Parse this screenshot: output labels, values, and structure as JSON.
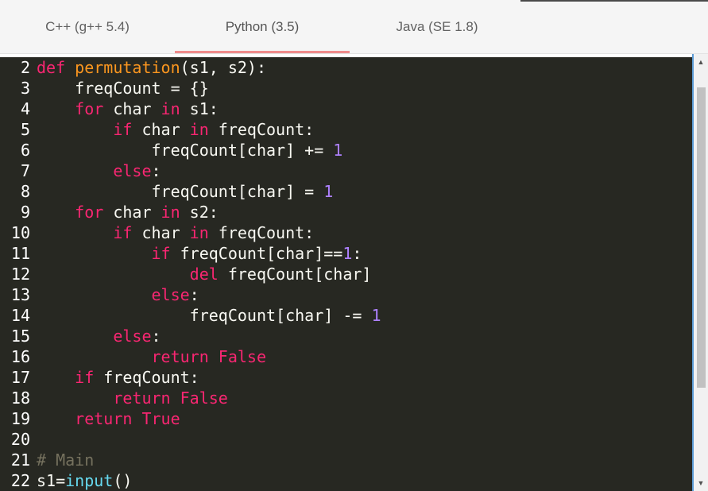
{
  "tabs": [
    {
      "label": "C++ (g++ 5.4)",
      "active": false
    },
    {
      "label": "Python (3.5)",
      "active": true
    },
    {
      "label": "Java (SE 1.8)",
      "active": false
    }
  ],
  "colors": {
    "editor_bg": "#272822",
    "keyword": "#f92672",
    "function": "#fd971f",
    "number": "#ae81ff",
    "builtin": "#66d9ef",
    "comment": "#75715e",
    "text": "#f8f8f2",
    "tab_indicator": "#ef8c8c",
    "scrollbar_border": "#5b9bd5"
  },
  "scrollbar": {
    "up_icon": "arrow-up-icon",
    "down_icon": "arrow-down-icon"
  },
  "code_lines": [
    {
      "num": "2",
      "tokens": [
        [
          "kw",
          "def"
        ],
        [
          "p",
          " "
        ],
        [
          "fn",
          "permutation"
        ],
        [
          "p",
          "(s1, s2):"
        ]
      ]
    },
    {
      "num": "3",
      "tokens": [
        [
          "p",
          "    freqCount = {}"
        ]
      ]
    },
    {
      "num": "4",
      "tokens": [
        [
          "p",
          "    "
        ],
        [
          "kw",
          "for"
        ],
        [
          "p",
          " char "
        ],
        [
          "kw",
          "in"
        ],
        [
          "p",
          " s1:"
        ]
      ]
    },
    {
      "num": "5",
      "tokens": [
        [
          "p",
          "        "
        ],
        [
          "kw",
          "if"
        ],
        [
          "p",
          " char "
        ],
        [
          "kw",
          "in"
        ],
        [
          "p",
          " freqCount:"
        ]
      ]
    },
    {
      "num": "6",
      "tokens": [
        [
          "p",
          "            freqCount[char] += "
        ],
        [
          "num",
          "1"
        ]
      ]
    },
    {
      "num": "7",
      "tokens": [
        [
          "p",
          "        "
        ],
        [
          "kw",
          "else"
        ],
        [
          "p",
          ":"
        ]
      ]
    },
    {
      "num": "8",
      "tokens": [
        [
          "p",
          "            freqCount[char] = "
        ],
        [
          "num",
          "1"
        ]
      ]
    },
    {
      "num": "9",
      "tokens": [
        [
          "p",
          "    "
        ],
        [
          "kw",
          "for"
        ],
        [
          "p",
          " char "
        ],
        [
          "kw",
          "in"
        ],
        [
          "p",
          " s2:"
        ]
      ]
    },
    {
      "num": "10",
      "tokens": [
        [
          "p",
          "        "
        ],
        [
          "kw",
          "if"
        ],
        [
          "p",
          " char "
        ],
        [
          "kw",
          "in"
        ],
        [
          "p",
          " freqCount:"
        ]
      ]
    },
    {
      "num": "11",
      "tokens": [
        [
          "p",
          "            "
        ],
        [
          "kw",
          "if"
        ],
        [
          "p",
          " freqCount[char]=="
        ],
        [
          "num",
          "1"
        ],
        [
          "p",
          ":"
        ]
      ]
    },
    {
      "num": "12",
      "tokens": [
        [
          "p",
          "                "
        ],
        [
          "kw",
          "del"
        ],
        [
          "p",
          " freqCount[char]"
        ]
      ]
    },
    {
      "num": "13",
      "tokens": [
        [
          "p",
          "            "
        ],
        [
          "kw",
          "else"
        ],
        [
          "p",
          ":"
        ]
      ]
    },
    {
      "num": "14",
      "tokens": [
        [
          "p",
          "                freqCount[char] -= "
        ],
        [
          "num",
          "1"
        ]
      ]
    },
    {
      "num": "15",
      "tokens": [
        [
          "p",
          "        "
        ],
        [
          "kw",
          "else"
        ],
        [
          "p",
          ":"
        ]
      ]
    },
    {
      "num": "16",
      "tokens": [
        [
          "p",
          "            "
        ],
        [
          "kw",
          "return"
        ],
        [
          "p",
          " "
        ],
        [
          "kw",
          "False"
        ]
      ]
    },
    {
      "num": "17",
      "tokens": [
        [
          "p",
          "    "
        ],
        [
          "kw",
          "if"
        ],
        [
          "p",
          " freqCount:"
        ]
      ]
    },
    {
      "num": "18",
      "tokens": [
        [
          "p",
          "        "
        ],
        [
          "kw",
          "return"
        ],
        [
          "p",
          " "
        ],
        [
          "kw",
          "False"
        ]
      ]
    },
    {
      "num": "19",
      "tokens": [
        [
          "p",
          "    "
        ],
        [
          "kw",
          "return"
        ],
        [
          "p",
          " "
        ],
        [
          "kw",
          "True"
        ]
      ]
    },
    {
      "num": "20",
      "tokens": []
    },
    {
      "num": "21",
      "tokens": [
        [
          "cm",
          "# Main"
        ]
      ]
    },
    {
      "num": "22",
      "tokens": [
        [
          "p",
          "s1="
        ],
        [
          "bi",
          "input"
        ],
        [
          "p",
          "()"
        ]
      ]
    }
  ]
}
